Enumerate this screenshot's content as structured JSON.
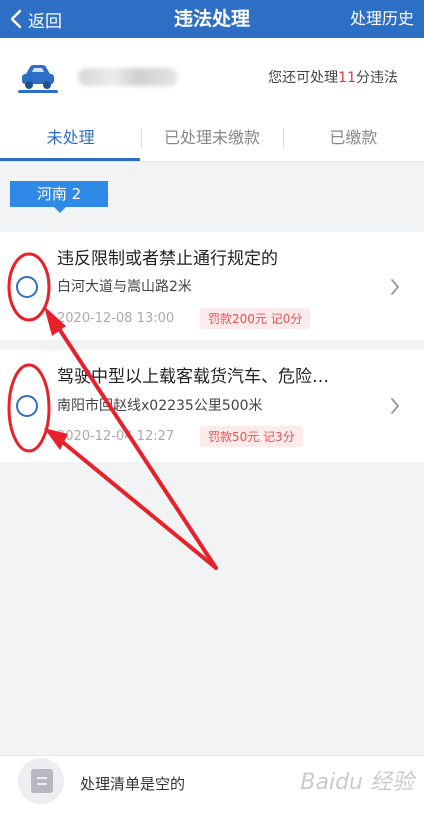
{
  "nav": {
    "back_label": "返回",
    "title": "违法处理",
    "history_label": "处理历史"
  },
  "vehicle": {
    "quota_prefix": "您还可处理",
    "quota_count": "11",
    "quota_suffix": "分违法"
  },
  "tabs": [
    {
      "label": "未处理",
      "active": true
    },
    {
      "label": "已处理未缴款",
      "active": false
    },
    {
      "label": "已缴款",
      "active": false
    }
  ],
  "region": {
    "label": "河南 2"
  },
  "violations": [
    {
      "title": "违反限制或者禁止通行规定的",
      "location": "白河大道与嵩山路2米",
      "time": "2020-12-08 13:00",
      "penalty": "罚款200元 记0分"
    },
    {
      "title": "驾驶中型以上载客载货汽车、危险…",
      "location": "南阳市回赵线x02235公里500米",
      "time": "2020-12-04 12:27",
      "penalty": "罚款50元 记3分"
    }
  ],
  "bottom": {
    "empty_text": "处理清单是空的",
    "watermark": "Baidu 经验"
  },
  "colors": {
    "brand": "#2e6fc6",
    "tag": "#2e8ae6",
    "accent_red": "#e33b2f",
    "annotation": "#e8202a"
  }
}
